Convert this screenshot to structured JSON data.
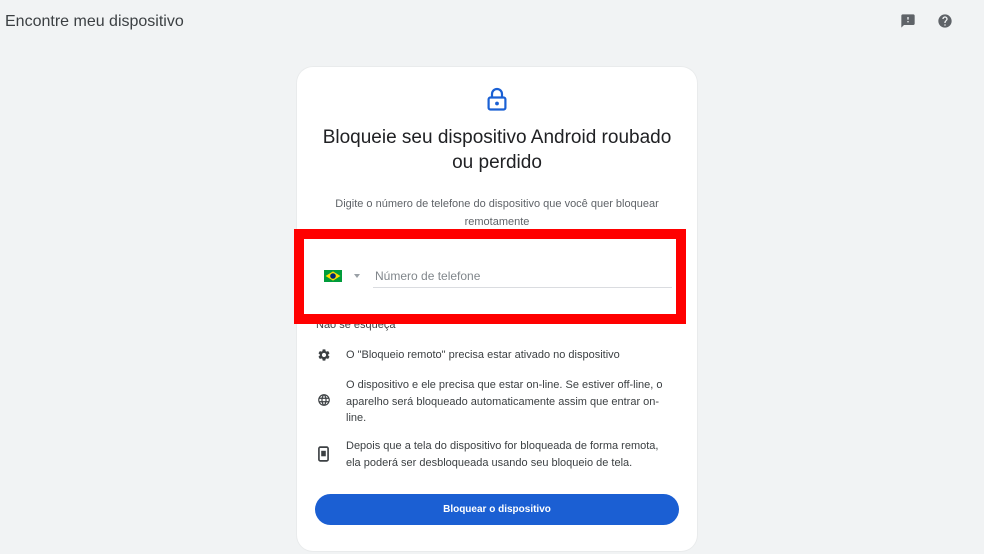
{
  "app": {
    "title": "Encontre meu dispositivo"
  },
  "header": {
    "feedback_icon": "feedback-icon",
    "help_icon": "help-icon"
  },
  "card": {
    "icon": "lock-icon",
    "title": "Bloqueie seu dispositivo Android roubado ou perdido",
    "subtitle": "Digite o número de telefone do dispositivo que você quer bloquear remotamente",
    "phone": {
      "country_flag": "brazil-flag-icon",
      "value": "",
      "placeholder": "Número de telefone"
    },
    "reminder_heading": "Não se esqueça",
    "reminders": [
      {
        "icon": "gear-icon",
        "text": "O \"Bloqueio remoto\" precisa estar ativado no dispositivo"
      },
      {
        "icon": "globe-icon",
        "text": "O dispositivo e ele precisa que estar on-line. Se estiver off-line, o aparelho será bloqueado automaticamente assim que entrar on-line."
      },
      {
        "icon": "phone-icon",
        "text": "Depois que a tela do dispositivo for bloqueada de forma remota, ela poderá ser desbloqueada usando seu bloqueio de tela."
      }
    ],
    "submit_label": "Bloquear o dispositivo"
  },
  "colors": {
    "accent": "#1a60d4",
    "button": "#1b5fd3",
    "highlight": "#ff0000",
    "page_background": "#f1f3f4"
  }
}
